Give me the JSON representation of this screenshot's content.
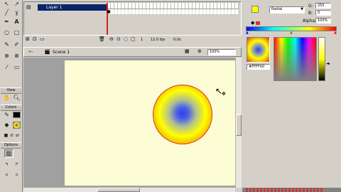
{
  "tools": {
    "icons": [
      "arrow-icon",
      "subselect-icon",
      "line-icon",
      "lasso-icon",
      "pen-icon",
      "text-icon",
      "oval-icon",
      "rectangle-icon",
      "pencil-icon",
      "brush-icon",
      "ink-bottle-icon",
      "paint-bucket-icon",
      "eyedropper-icon",
      "eraser-icon"
    ],
    "glyphs": [
      "↖",
      "↗",
      "╱",
      "ɣ",
      "✒",
      "A",
      "○",
      "□",
      "✎",
      "✐",
      "⊕",
      "⊗",
      "⁄",
      "▭"
    ],
    "view_label": "View",
    "colors_label": "Colors",
    "options_label": "Options"
  },
  "timeline": {
    "layer_name": "Layer 1",
    "frame_number": "1",
    "fps": "12.0 fps",
    "time": "0.0s"
  },
  "scene": {
    "name": "Scene 1",
    "zoom": "100%"
  },
  "mixer": {
    "fill_type": "Radial",
    "g_label": "G:",
    "g_value": "255",
    "b_label": "B:",
    "b_value": "0",
    "alpha_label": "Alpha:",
    "alpha_value": "100%",
    "hex_value": "#FFFF00"
  },
  "colors": {
    "stage_bg": "#fcfdd4",
    "gradient_center": "#3040e0",
    "gradient_mid": "#ffff00",
    "gradient_outer": "#e03020"
  }
}
